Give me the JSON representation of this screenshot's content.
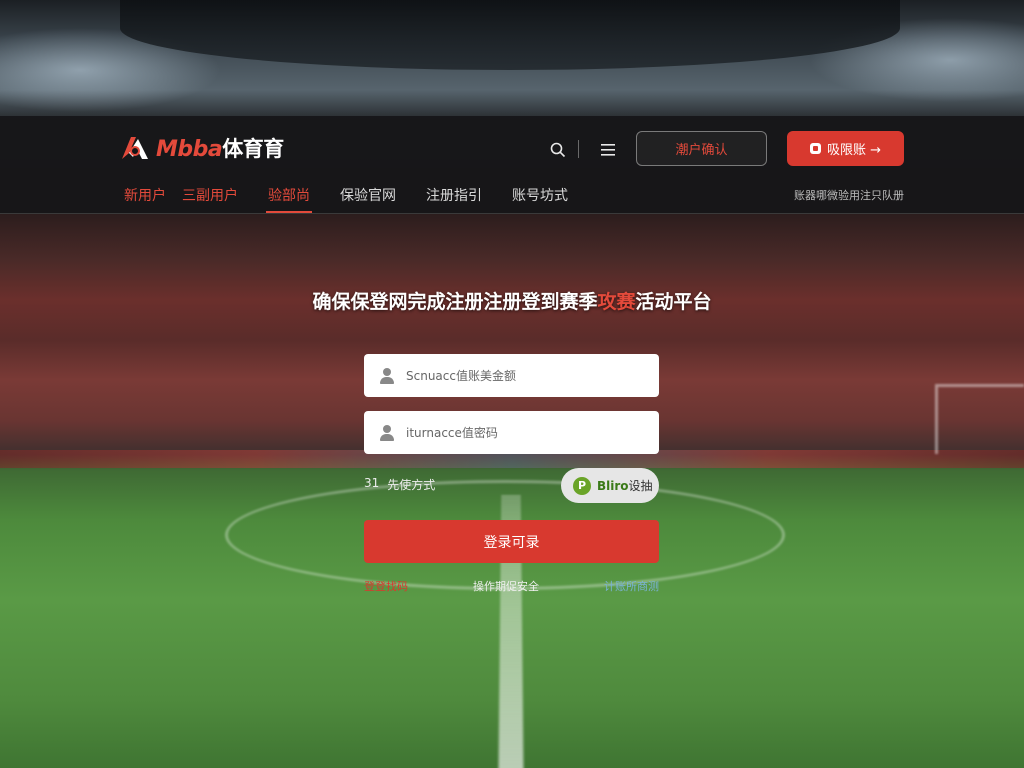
{
  "header": {
    "logo_latin": "Mbba",
    "logo_cn": "体育育",
    "login_label": "潮户确认",
    "register_label": "吸限账 →"
  },
  "nav": {
    "items": [
      {
        "label": "新用户",
        "style": "red"
      },
      {
        "label": "三副用户",
        "style": "red"
      },
      {
        "label": "验部尚",
        "style": "red-active"
      },
      {
        "label": "保验官网",
        "style": "normal"
      },
      {
        "label": "注册指引",
        "style": "normal"
      },
      {
        "label": "账号坊式",
        "style": "normal"
      }
    ],
    "notice": "账器哪微验用注只队册"
  },
  "main": {
    "headline_before": "确保保登网完成注册注册登到",
    "headline_mid": "赛季",
    "headline_accent": "攻赛",
    "headline_after": "活动平台",
    "username_placeholder": "Scnuacc值账美金额",
    "password_placeholder": "iturnacce值密码",
    "method_prefix": "31",
    "method_label": "先使方式",
    "quick_login_icon": "P",
    "quick_login_label_en": "Bliro",
    "quick_login_label_cn": "设抽",
    "submit_label": "登录可录",
    "links": [
      "登登找码",
      "操作期促安全",
      "计账所商测"
    ]
  },
  "colors": {
    "accent": "#d8392f",
    "accent_text": "#e34a3b",
    "header_bg": "#161618",
    "quick_login_green": "#6aa428"
  },
  "icons": [
    "logo-icon",
    "search-icon",
    "menu-icon",
    "user-icon",
    "lock-icon",
    "quick-login-icon"
  ]
}
